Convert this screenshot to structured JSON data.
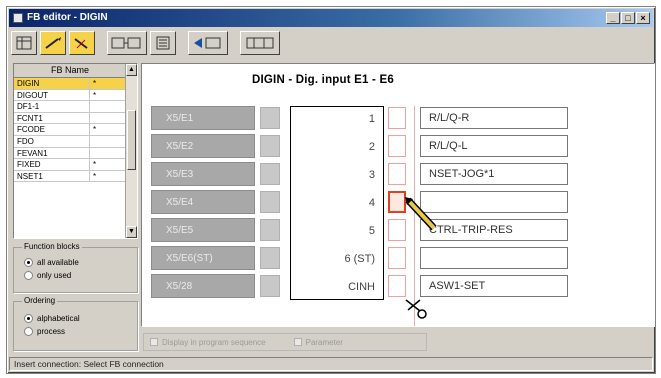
{
  "window": {
    "title": "FB editor - DIGIN",
    "buttons": [
      "_",
      "□",
      "×"
    ]
  },
  "toolbar": {
    "icons": [
      "grid-icon",
      "connect-pen-icon",
      "disconnect-pen-icon",
      "fb-view-icon",
      "fb-list-icon",
      "move-left-icon",
      "edit-icon",
      "print-icon"
    ]
  },
  "fb_list": {
    "header": "FB Name",
    "rows": [
      {
        "name": "DIGIN",
        "flag": "*",
        "selected": true
      },
      {
        "name": "DIGOUT",
        "flag": "*",
        "selected": false
      },
      {
        "name": "DF1-1",
        "flag": "",
        "selected": false
      },
      {
        "name": "FCNT1",
        "flag": "",
        "selected": false
      },
      {
        "name": "FCODE",
        "flag": "*",
        "selected": false
      },
      {
        "name": "FDO",
        "flag": "",
        "selected": false
      },
      {
        "name": "FEVAN1",
        "flag": "",
        "selected": false
      },
      {
        "name": "FIXED",
        "flag": "*",
        "selected": false
      },
      {
        "name": "NSET1",
        "flag": "*",
        "selected": false
      }
    ]
  },
  "function_blocks": {
    "title": "Function blocks",
    "options": [
      {
        "label": "all available",
        "selected": true
      },
      {
        "label": "only used",
        "selected": false
      }
    ]
  },
  "ordering": {
    "title": "Ordering",
    "options": [
      {
        "label": "alphabetical",
        "selected": true
      },
      {
        "label": "process",
        "selected": false
      }
    ]
  },
  "fb": {
    "title": "DIGIN - Dig. input E1 - E6",
    "inputs": [
      "X5/E1",
      "X5/E2",
      "X5/E3",
      "X5/E4",
      "X5/E5",
      "X5/E6(ST)",
      "X5/28"
    ],
    "pins": [
      "1",
      "2",
      "3",
      "4",
      "5",
      "6 (ST)",
      "CINH"
    ],
    "outputs": [
      "R/L/Q-R",
      "R/L/Q-L",
      "NSET-JOG*1",
      "",
      "TRIP-RES",
      "",
      "ASW1-SET"
    ],
    "output_partial": "CTRL-TRIP-RES",
    "active_pin_index": 3
  },
  "options": {
    "checkbox1": "Display in program sequence",
    "checkbox2": "Parameter"
  },
  "status": {
    "text": "Insert connection: Select FB connection"
  },
  "colors": {
    "selected": "#f6d24a",
    "titlebar": "#0a246a",
    "active_pin": "#e04020"
  }
}
